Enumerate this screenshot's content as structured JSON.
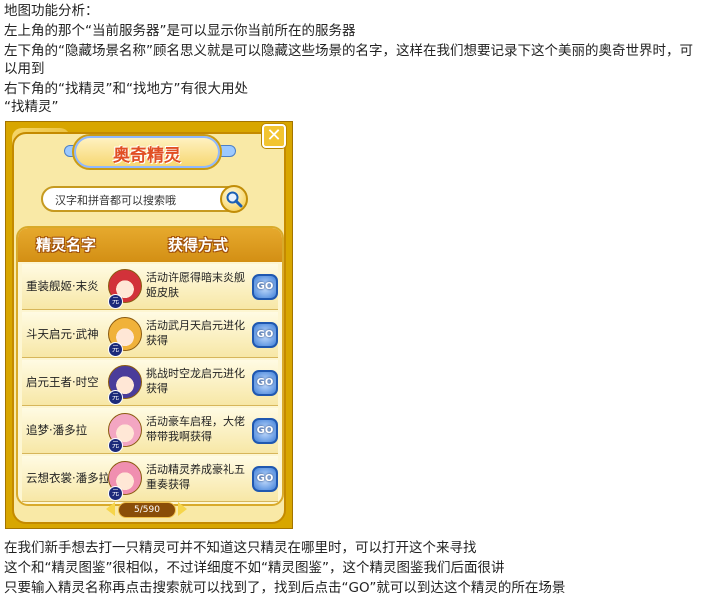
{
  "article": {
    "heading": "地图功能分析：",
    "p1": "左上角的那个“当前服务器”是可以显示你当前所在的服务器",
    "p2": "左下角的“隐藏场景名称”顾名思义就是可以隐藏这些场景的名字，这样在我们想要记录下这个美丽的奥奇世界时，可以用到",
    "p3": "右下角的“找精灵”和“找地方”有很大用处",
    "p4": "“找精灵”",
    "p5": "在我们新手想去打一只精灵可并不知道这只精灵在哪里时，可以打开这个来寻找",
    "p6": "这个和“精灵图鉴”很相似，不过详细度不如“精灵图鉴”，这个精灵图鉴我们后面很讲",
    "p7": "只要输入精灵名称再点击搜索就可以找到了，找到后点击“GO”就可以到达这个精灵的所在场景"
  },
  "panel": {
    "title": "奥奇精灵",
    "close_label": "✕",
    "search_placeholder": "汉字和拼音都可以搜索哦",
    "search_icon": "search-icon",
    "col_name": "精灵名字",
    "col_method": "获得方式",
    "go_label": "GO",
    "badge_label": "元",
    "pager": "5/590",
    "rows": [
      {
        "name": "重装舰姬·末炎",
        "method": "活动许愿得暗末炎舰姬皮肤",
        "avatar_color": "#d2323a"
      },
      {
        "name": "斗天启元·武神",
        "method": "活动武月天启元进化获得",
        "avatar_color": "#f0b23a"
      },
      {
        "name": "启元王者·时空",
        "method": "挑战时空龙启元进化获得",
        "avatar_color": "#4a3c9a"
      },
      {
        "name": "追梦·潘多拉",
        "method": "活动豪车启程，大佬带带我啊获得",
        "avatar_color": "#f3a6c2"
      },
      {
        "name": "云想衣裳·潘多拉",
        "method": "活动精灵养成豪礼五重奏获得",
        "avatar_color": "#f08fb0"
      }
    ]
  },
  "colors": {
    "panel_gold": "#d8a600",
    "title_red": "#e14f24",
    "go_blue": "#3d7ed8"
  }
}
